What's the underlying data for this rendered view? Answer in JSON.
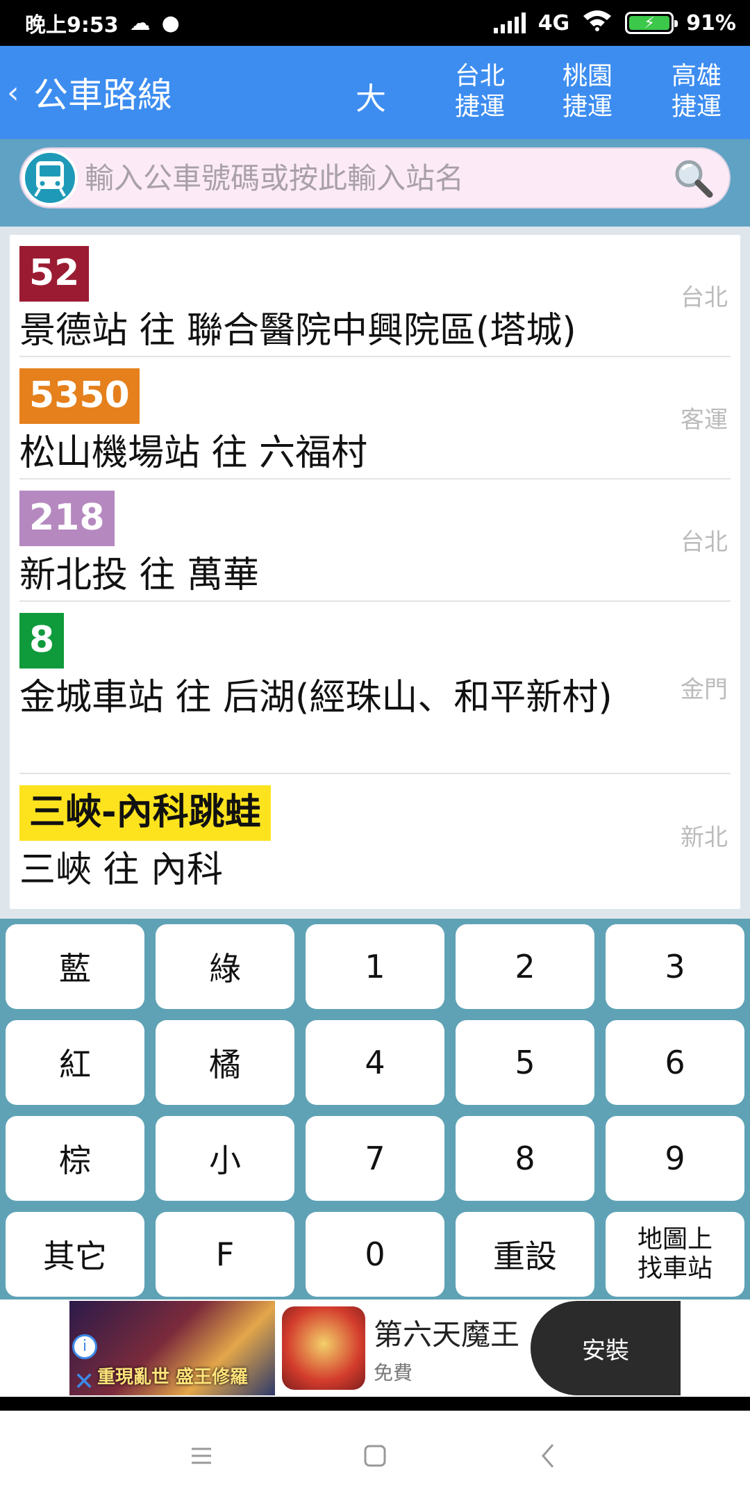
{
  "status_bar": {
    "time": "晚上9:53",
    "network": "4G",
    "battery": "91%"
  },
  "app_bar": {
    "back": "‹",
    "title": "公車路線",
    "font_size_toggle": "大",
    "metro_links": [
      {
        "line1": "台北",
        "line2": "捷運"
      },
      {
        "line1": "桃園",
        "line2": "捷運"
      },
      {
        "line1": "高雄",
        "line2": "捷運"
      }
    ]
  },
  "search": {
    "placeholder": "輸入公車號碼或按此輸入站名"
  },
  "routes": [
    {
      "number": "52",
      "color": "#9b1c32",
      "text_color": "#ffffff",
      "destination": "景德站 往 聯合醫院中興院區(塔城)",
      "region": "台北"
    },
    {
      "number": "5350",
      "color": "#e5801c",
      "text_color": "#ffffff",
      "destination": "松山機場站 往 六福村",
      "region": "客運"
    },
    {
      "number": "218",
      "color": "#b589bf",
      "text_color": "#ffffff",
      "destination": "新北投 往 萬華",
      "region": "台北"
    },
    {
      "number": "8",
      "color": "#0f9a3c",
      "text_color": "#ffffff",
      "destination": "金城車站 往 后湖(經珠山、和平新村)",
      "region": "金門"
    },
    {
      "number": "三峽-內科跳蛙",
      "color": "#fde31e",
      "text_color": "#111111",
      "destination": "三峽 往 內科",
      "region": "新北"
    }
  ],
  "keypad": {
    "keys": [
      "藍",
      "綠",
      "1",
      "2",
      "3",
      "紅",
      "橘",
      "4",
      "5",
      "6",
      "棕",
      "小",
      "7",
      "8",
      "9",
      "其它",
      "F",
      "0",
      "重設"
    ],
    "last_key_line1": "地圖上",
    "last_key_line2": "找車站"
  },
  "ad": {
    "banner_caption": "重現亂世 盛王修羅",
    "app_name": "第六天魔王",
    "price": "免費",
    "install": "安裝",
    "info": "i",
    "close": "✕"
  },
  "colors": {
    "app_bar": "#3d8df0",
    "keypad_bg": "#5fa2b5"
  }
}
